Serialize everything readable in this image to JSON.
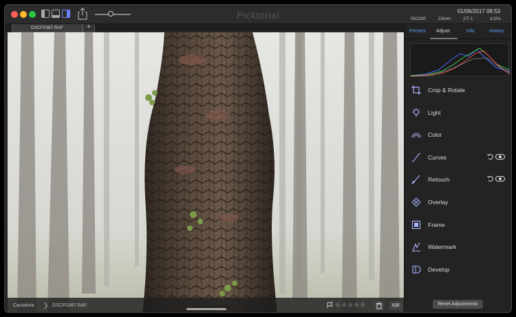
{
  "app": {
    "title": "Picktorial"
  },
  "file_tab": {
    "name": "DSCF0387.RAF",
    "add": "+"
  },
  "meta": {
    "date": "01/06/2017 08:53",
    "iso": "ISO100",
    "focal": "23mm",
    "aperture": "ƒ/7.1",
    "shutter": "1/10s"
  },
  "sidebar": {
    "tabs": [
      {
        "label": "Presets"
      },
      {
        "label": "Adjust"
      },
      {
        "label": "Info"
      },
      {
        "label": "History"
      }
    ],
    "tools": [
      {
        "label": "Crop & Rotate",
        "icon": "crop-rotate-icon"
      },
      {
        "label": "Light",
        "icon": "light-bulb-icon"
      },
      {
        "label": "Color",
        "icon": "color-rainbow-icon"
      },
      {
        "label": "Curves",
        "icon": "curves-icon",
        "has_toggle": true
      },
      {
        "label": "Retouch",
        "icon": "retouch-brush-icon",
        "has_toggle": true
      },
      {
        "label": "Overlay",
        "icon": "overlay-icon"
      },
      {
        "label": "Frame",
        "icon": "frame-icon"
      },
      {
        "label": "Watermark",
        "icon": "watermark-icon"
      },
      {
        "label": "Develop",
        "icon": "develop-icon"
      }
    ],
    "reset_label": "Reset Adjustments"
  },
  "photo_bar": {
    "breadcrumb": [
      "Cantabria",
      "DSCF0387.RAF"
    ],
    "separator": "❯",
    "stars": "☆☆☆☆☆",
    "ab_label": "A|B"
  },
  "colors": {
    "accent": "#5d9cf0",
    "background": "#262626"
  }
}
